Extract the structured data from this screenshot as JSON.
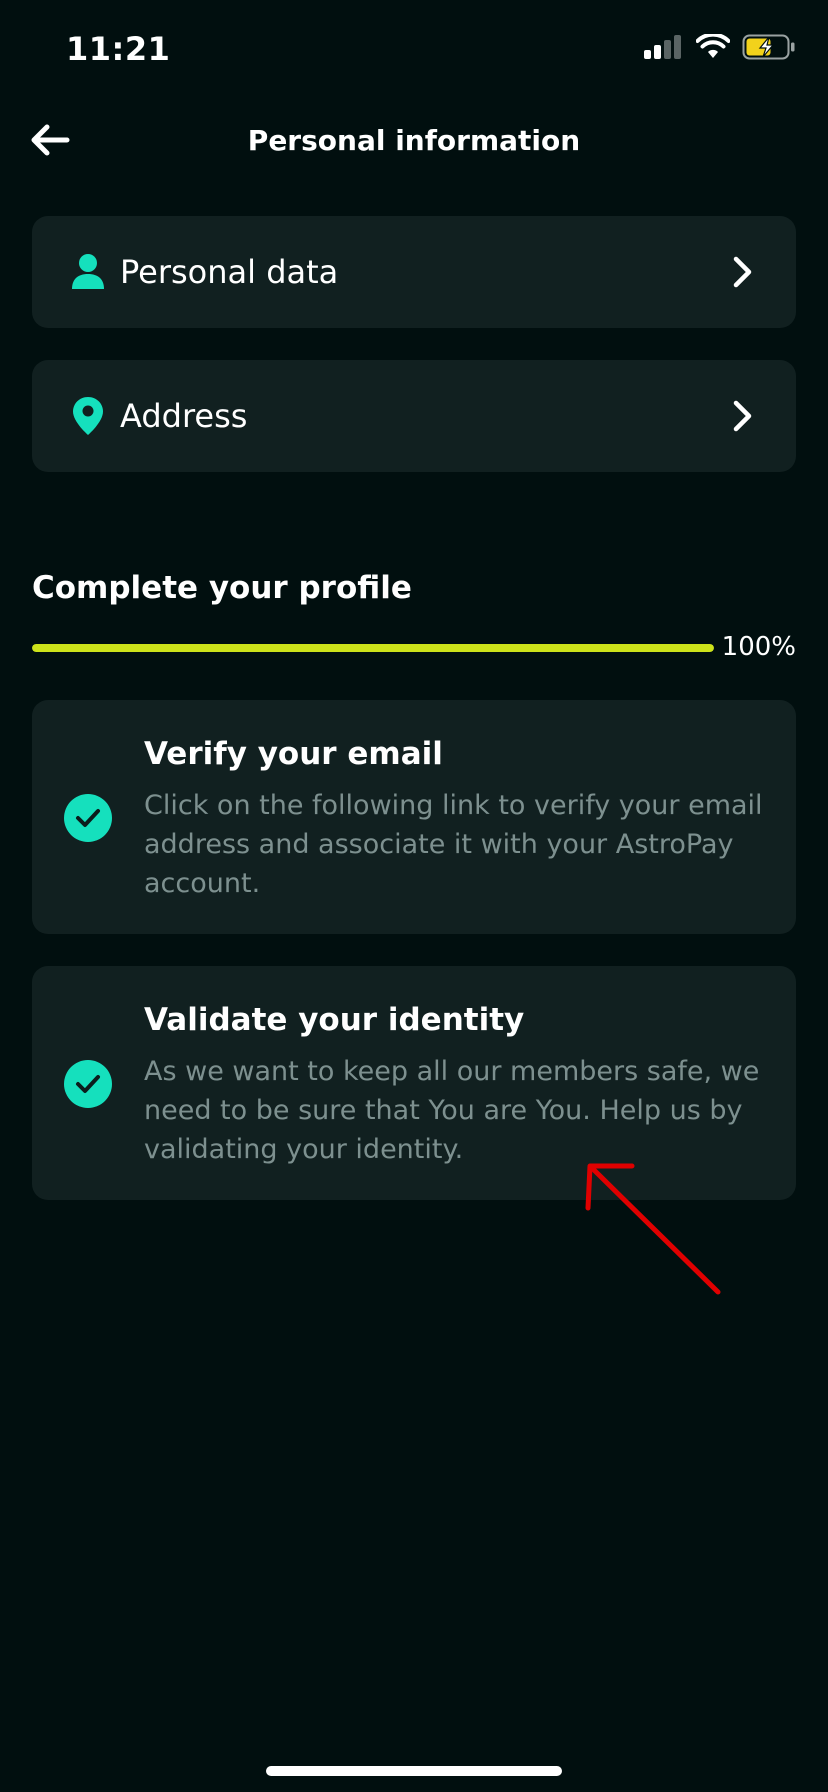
{
  "status_bar": {
    "time": "11:21",
    "signal_icon": "cellular-signal-icon",
    "wifi_icon": "wifi-icon",
    "battery_icon": "battery-charging-icon"
  },
  "header": {
    "back_icon": "arrow-left-icon",
    "title": "Personal information"
  },
  "menu": {
    "items": [
      {
        "label": "Personal data",
        "icon": "person-icon",
        "chevron": "chevron-right-icon"
      },
      {
        "label": "Address",
        "icon": "location-pin-icon",
        "chevron": "chevron-right-icon"
      }
    ]
  },
  "profile": {
    "title": "Complete your profile",
    "progress_label": "100%",
    "progress_percent": 100,
    "tasks": [
      {
        "title": "Verify your email",
        "description": "Click on the following link to verify your email address and associate it with your AstroPay account.",
        "status_icon": "check-circle-icon"
      },
      {
        "title": "Validate your identity",
        "description": "As we want to keep all our members safe, we need to be sure that You are You. Help us by validating your identity.",
        "status_icon": "check-circle-icon"
      }
    ]
  },
  "colors": {
    "background": "#010f0f",
    "card": "#112020",
    "accent_teal": "#15e0bd",
    "progress_lime": "#cde31a",
    "muted_text": "#7d908f",
    "annotation_red": "#e00000"
  }
}
